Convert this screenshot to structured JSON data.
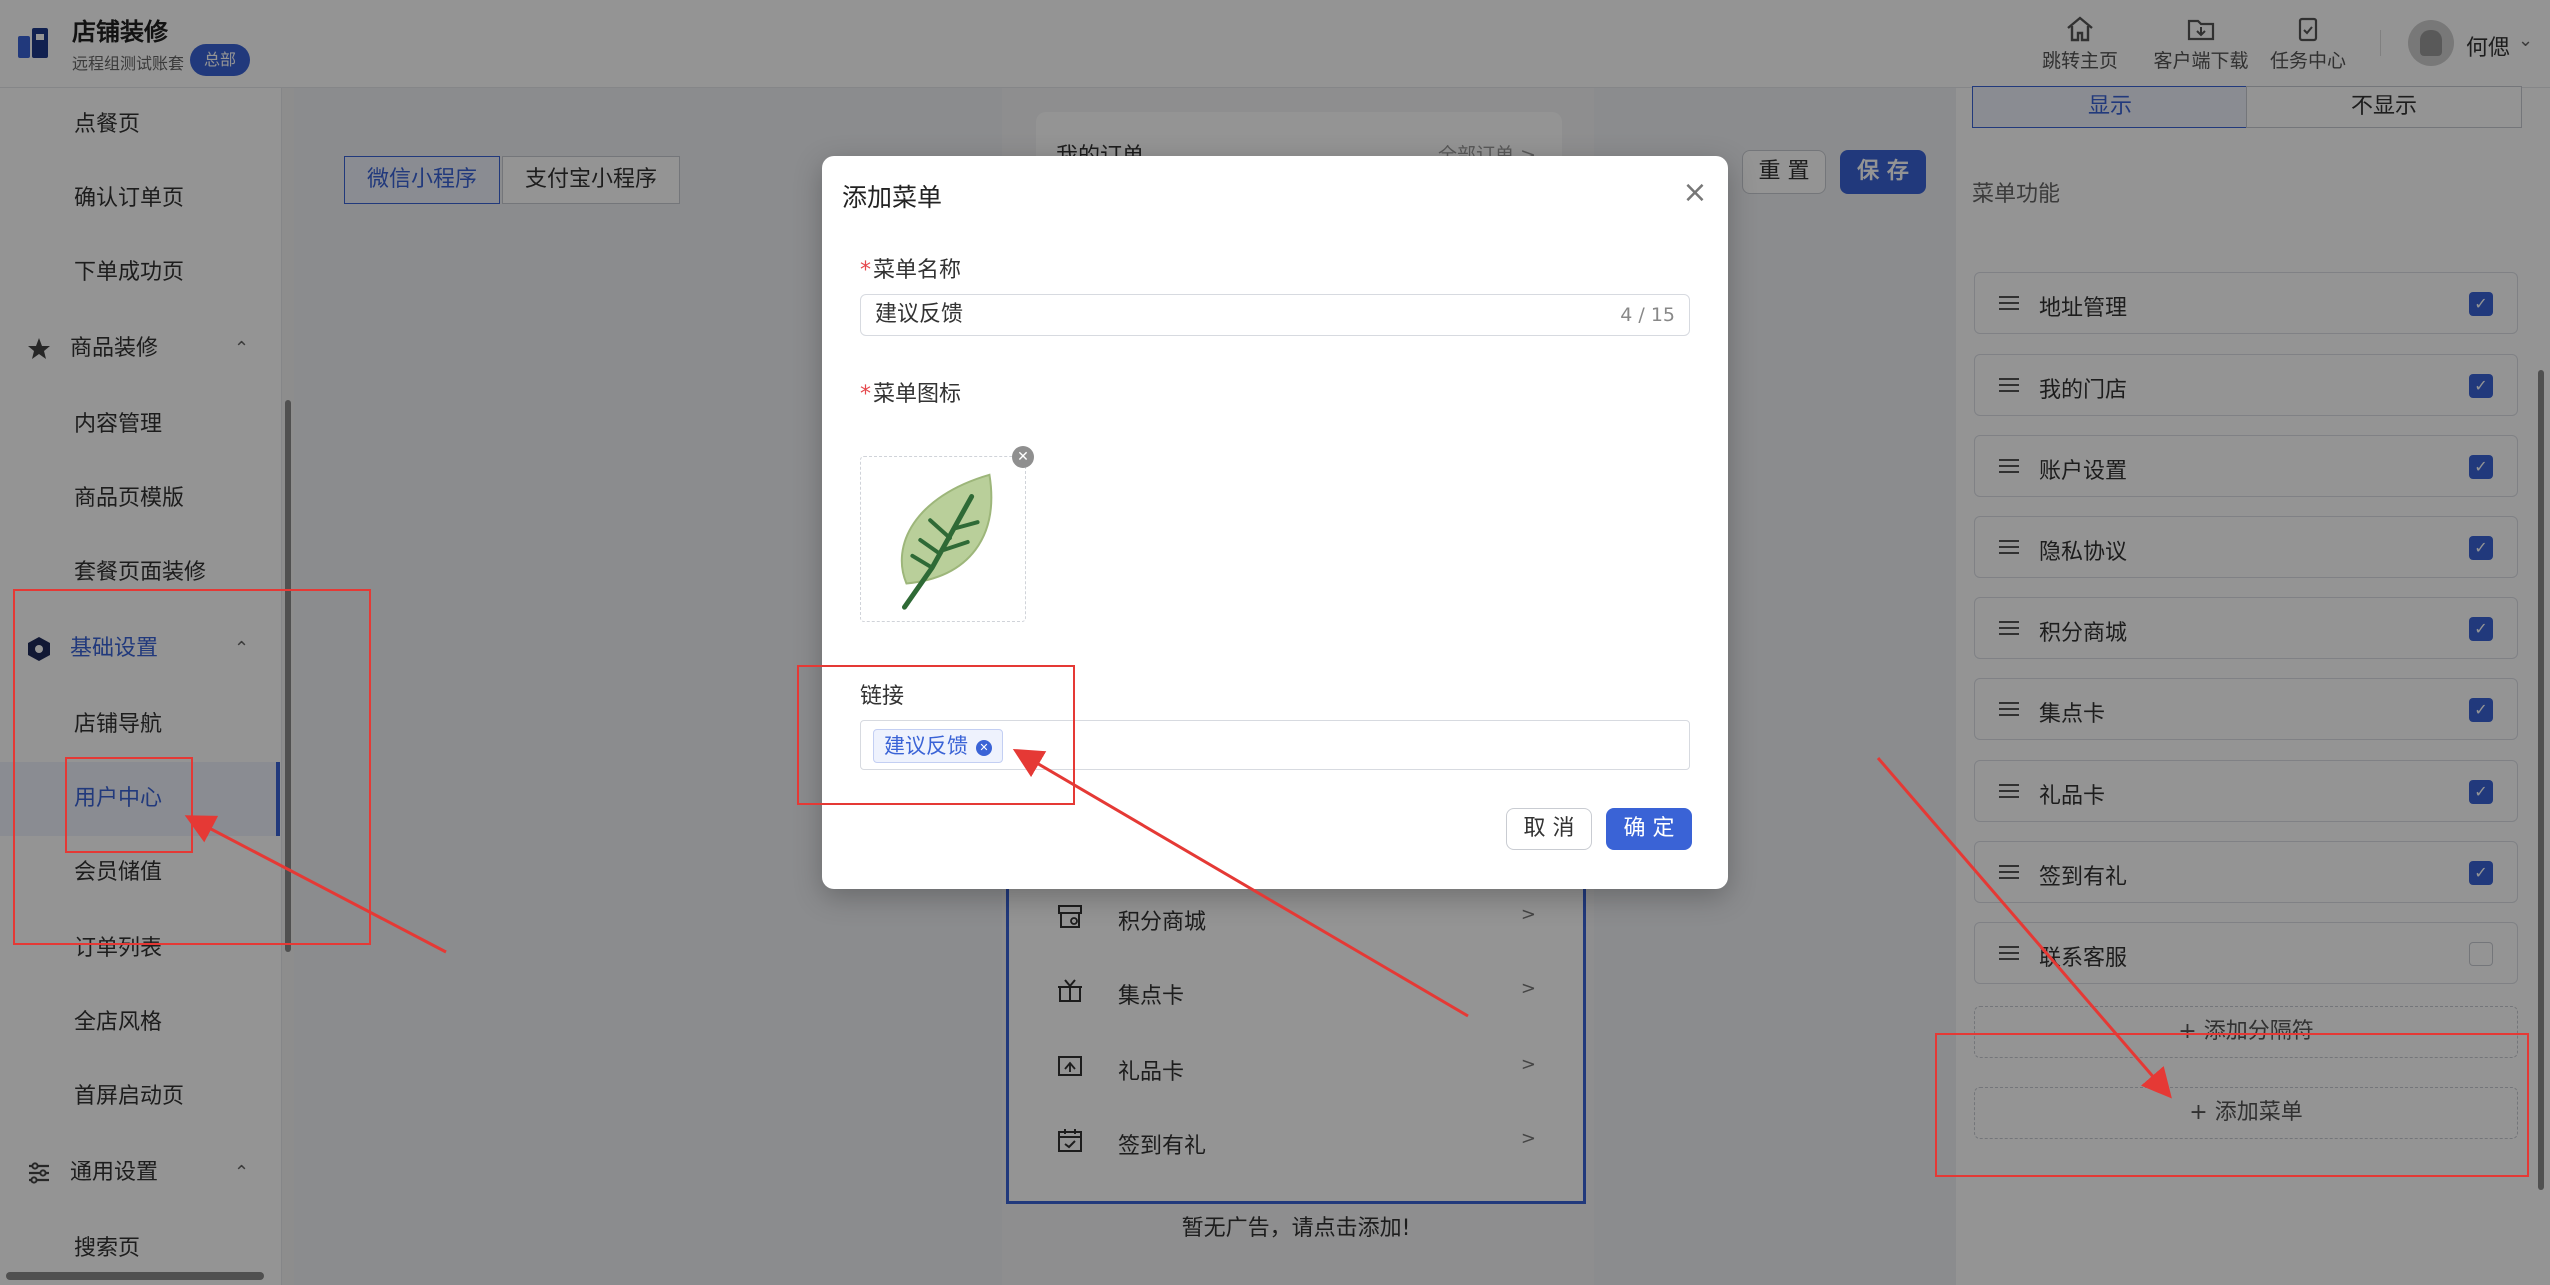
{
  "header": {
    "title": "店铺装修",
    "subtitle": "远程组测试账套",
    "badge": "总部",
    "actions": [
      {
        "label": "跳转主页",
        "icon": "home-icon"
      },
      {
        "label": "客户端下载",
        "icon": "download-folder-icon"
      },
      {
        "label": "任务中心",
        "icon": "clipboard-check-icon"
      }
    ],
    "user_name": "何偲"
  },
  "sidebar": {
    "items": [
      {
        "label": "点餐页",
        "type": "item"
      },
      {
        "label": "确认订单页",
        "type": "item"
      },
      {
        "label": "下单成功页",
        "type": "item"
      },
      {
        "label": "商品装修",
        "type": "group",
        "icon": "star-icon"
      },
      {
        "label": "内容管理",
        "type": "item"
      },
      {
        "label": "商品页模版",
        "type": "item"
      },
      {
        "label": "套餐页面装修",
        "type": "item"
      },
      {
        "label": "基础设置",
        "type": "group",
        "icon": "hexagon-settings-icon",
        "active": true
      },
      {
        "label": "店铺导航",
        "type": "item"
      },
      {
        "label": "用户中心",
        "type": "item",
        "active": true
      },
      {
        "label": "会员储值",
        "type": "item"
      },
      {
        "label": "订单列表",
        "type": "item"
      },
      {
        "label": "全店风格",
        "type": "item"
      },
      {
        "label": "首屏启动页",
        "type": "item"
      },
      {
        "label": "通用设置",
        "type": "group",
        "icon": "sliders-icon"
      },
      {
        "label": "搜索页",
        "type": "item"
      }
    ]
  },
  "main": {
    "platform_tabs": [
      "微信小程序",
      "支付宝小程序"
    ],
    "reset_label": "重 置",
    "save_label": "保 存"
  },
  "phone": {
    "order_card": {
      "title": "我的订单",
      "link": "全部订单 >"
    },
    "menu_rows": [
      {
        "label": "积分商城",
        "icon": "shop-icon"
      },
      {
        "label": "集点卡",
        "icon": "gift-box-icon"
      },
      {
        "label": "礼品卡",
        "icon": "card-icon"
      },
      {
        "label": "签到有礼",
        "icon": "calendar-check-icon"
      }
    ],
    "arrow": ">",
    "no_ad": "暂无广告，请点击添加!"
  },
  "right_panel": {
    "display_options": [
      "显示",
      "不显示"
    ],
    "section_title": "菜单功能",
    "menu_items": [
      {
        "label": "地址管理",
        "checked": true
      },
      {
        "label": "我的门店",
        "checked": true
      },
      {
        "label": "账户设置",
        "checked": true
      },
      {
        "label": "隐私协议",
        "checked": true
      },
      {
        "label": "积分商城",
        "checked": true
      },
      {
        "label": "集点卡",
        "checked": true
      },
      {
        "label": "礼品卡",
        "checked": true
      },
      {
        "label": "签到有礼",
        "checked": true
      },
      {
        "label": "联系客服",
        "checked": false
      }
    ],
    "add_separator": "+ 添加分隔符",
    "add_menu": "+ 添加菜单"
  },
  "modal": {
    "title": "添加菜单",
    "name_label": "菜单名称",
    "name_value": "建议反馈",
    "name_count": "4 / 15",
    "icon_label": "菜单图标",
    "icon_name": "leaf-icon",
    "link_label": "链接",
    "link_tag": "建议反馈",
    "cancel_label": "取 消",
    "ok_label": "确 定"
  },
  "colors": {
    "accent": "#3a63d6",
    "annotation": "#e53935"
  }
}
